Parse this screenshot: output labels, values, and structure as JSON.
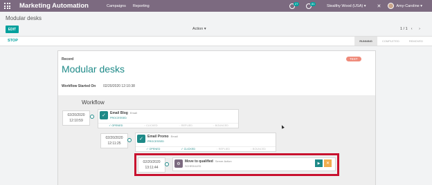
{
  "navbar": {
    "app_title": "Marketing Automation",
    "menu": [
      "Campaigns",
      "Reporting"
    ],
    "messages_count": "27",
    "activities_count": "81",
    "company": "Stealthy Wood (USA)",
    "user": "Amy-Caroline"
  },
  "control_panel": {
    "breadcrumb": "Modular desks",
    "edit_label": "EDIT",
    "action_label": "Action",
    "pager_value": "1 / 1",
    "pager_arrows": "‹ ›"
  },
  "statusbar": {
    "stop_label": "STOP",
    "stages": [
      {
        "label": "RUNNING",
        "active": true
      },
      {
        "label": "COMPLETED",
        "active": false
      },
      {
        "label": "REMOVED",
        "active": false
      }
    ]
  },
  "record": {
    "label": "Record",
    "name": "Modular desks",
    "state_badge": "TEST",
    "workflow_started_label": "Workflow Started On",
    "workflow_started_value": "02/20/2020 12:10:38"
  },
  "workflow": {
    "title": "Workflow",
    "activities": [
      {
        "date": "02/20/2020",
        "time": "12:10:59",
        "name": "Email Blog",
        "type": "Email",
        "state": "PROCESSED",
        "tracks": [
          {
            "label": "OPENED",
            "on": true
          },
          {
            "label": "CLICKED",
            "on": false
          },
          {
            "label": "REPLIED",
            "on": false
          },
          {
            "label": "BOUNCED",
            "on": false
          }
        ]
      },
      {
        "date": "02/20/2020",
        "time": "12:11:25",
        "name": "Email Promo",
        "type": "Email",
        "state": "PROCESSED",
        "tracks": [
          {
            "label": "OPENED",
            "on": true
          },
          {
            "label": "CLICKED",
            "on": true
          },
          {
            "label": "REPLIED",
            "on": false
          },
          {
            "label": "BOUNCED",
            "on": false
          }
        ]
      },
      {
        "date": "02/20/2020",
        "time": "13:11:44",
        "name": "Move to qualified",
        "type": "Server Action",
        "state": "SCHEDULED",
        "tracks": []
      }
    ]
  },
  "colors": {
    "navbar": "#7c6a80",
    "accent": "#1e8a88",
    "badge": "#ef8a7a",
    "highlight": "#c8102e",
    "cancel": "#f0ad4e"
  },
  "icons": {
    "apps": "grid-icon",
    "messages": "chat-icon",
    "activities": "clock-icon",
    "close": "close-icon",
    "processed": "check-icon",
    "scheduled": "gear-icon",
    "run": "play-icon",
    "cancel": "x-icon"
  }
}
